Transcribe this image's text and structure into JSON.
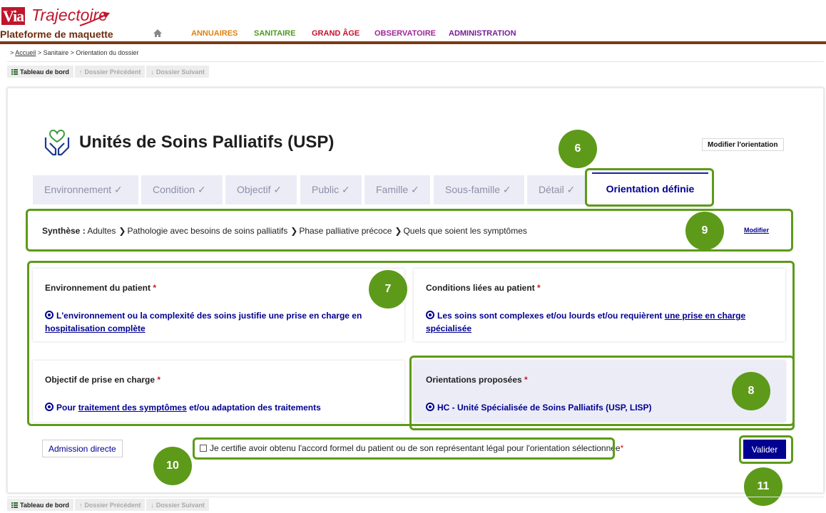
{
  "header": {
    "logo_via": "Via",
    "logo_trajectoire": "Trajectoire",
    "platform_title": "Plateforme de maquette",
    "nav": [
      {
        "label": "ANNUAIRES",
        "color": "#e0820c"
      },
      {
        "label": "SANITAIRE",
        "color": "#4e9b1d"
      },
      {
        "label": "GRAND ÂGE",
        "color": "#c8102e"
      },
      {
        "label": "OBSERVATOIRE",
        "color": "#a0249c"
      },
      {
        "label": "ADMINISTRATION",
        "color": "#7a1c9a"
      }
    ]
  },
  "breadcrumb": {
    "prefix": ">",
    "home": "Accueil",
    "rest": "> Sanitaire > Orientation du dossier"
  },
  "toolbar": {
    "dashboard": "Tableau de bord",
    "previous": "Dossier Précédent",
    "next": "Dossier Suivant"
  },
  "page": {
    "title": "Unités de Soins Palliatifs (USP)",
    "modify_orientation": "Modifier l'orientation"
  },
  "tabs": [
    {
      "label": "Environnement ✓"
    },
    {
      "label": "Condition ✓"
    },
    {
      "label": "Objectif ✓"
    },
    {
      "label": "Public ✓"
    },
    {
      "label": "Famille ✓"
    },
    {
      "label": "Sous-famille ✓"
    },
    {
      "label": "Détail ✓"
    }
  ],
  "active_tab": "Orientation définie",
  "synthese": {
    "label": "Synthèse :",
    "items": [
      "Adultes",
      "Pathologie avec besoins de soins palliatifs",
      "Phase palliative précoce",
      "Quels que soient les symptômes"
    ],
    "modify": "Modifier"
  },
  "panels": {
    "environnement": {
      "title": "Environnement du patient",
      "value_part1": "L'environnement ou la complexité des soins justifie une prise en charge en",
      "value_link": "hospitalisation complète"
    },
    "conditions": {
      "title": "Conditions liées au patient",
      "value_part1": "Les soins sont complexes et/ou lourds et/ou requièrent",
      "value_link": "une prise en charge spécialisée"
    },
    "objectif": {
      "title": "Objectif de prise en charge",
      "value_part1": "Pour",
      "value_link": "traitement des symptômes",
      "value_part2": "et/ou adaptation des traitements"
    },
    "orientations": {
      "title": "Orientations proposées",
      "value": "HC - Unité Spécialisée de Soins Palliatifs (USP, LISP)"
    },
    "required_mark": "*"
  },
  "footer": {
    "admission": "Admission directe",
    "certify": "Je certifie avoir obtenu l'accord formel du patient ou de son représentant légal pour l'orientation sélectionnée",
    "required_mark": "*",
    "validate": "Valider"
  },
  "markers": [
    "6",
    "7",
    "8",
    "9",
    "10",
    "11"
  ],
  "colors": {
    "accent": "#000091",
    "annotation": "#5d9a1a",
    "header_bar": "#7b3a14",
    "required": "#c9191e"
  }
}
